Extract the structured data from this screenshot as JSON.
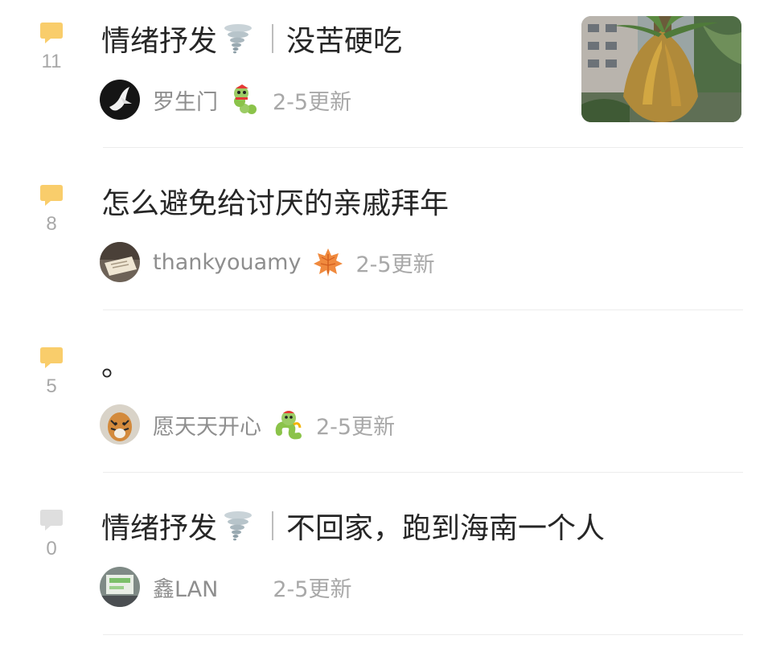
{
  "posts": [
    {
      "comment_count": "11",
      "title_tag": "情绪抒发",
      "title": "没苦硬吃",
      "author": "罗生门",
      "updated": "2-5更新",
      "badge_icon": "caterpillar-sticker",
      "has_thumbnail": true,
      "comment_icon_color": "#f9cd6b"
    },
    {
      "comment_count": "8",
      "title": "怎么避免给讨厌的亲戚拜年",
      "author": "thankyouamy",
      "updated": "2-5更新",
      "badge_icon": "maple-leaf-sticker",
      "comment_icon_color": "#f9cd6b"
    },
    {
      "comment_count": "5",
      "title": "。",
      "author": "愿天天开心",
      "updated": "2-5更新",
      "badge_icon": "snake-sticker",
      "comment_icon_color": "#f9cd6b"
    },
    {
      "comment_count": "0",
      "title_tag": "情绪抒发",
      "title": "不回家，跑到海南一个人",
      "author": "鑫LAN",
      "updated": "2-5更新",
      "comment_icon_color": "#dedede"
    }
  ]
}
